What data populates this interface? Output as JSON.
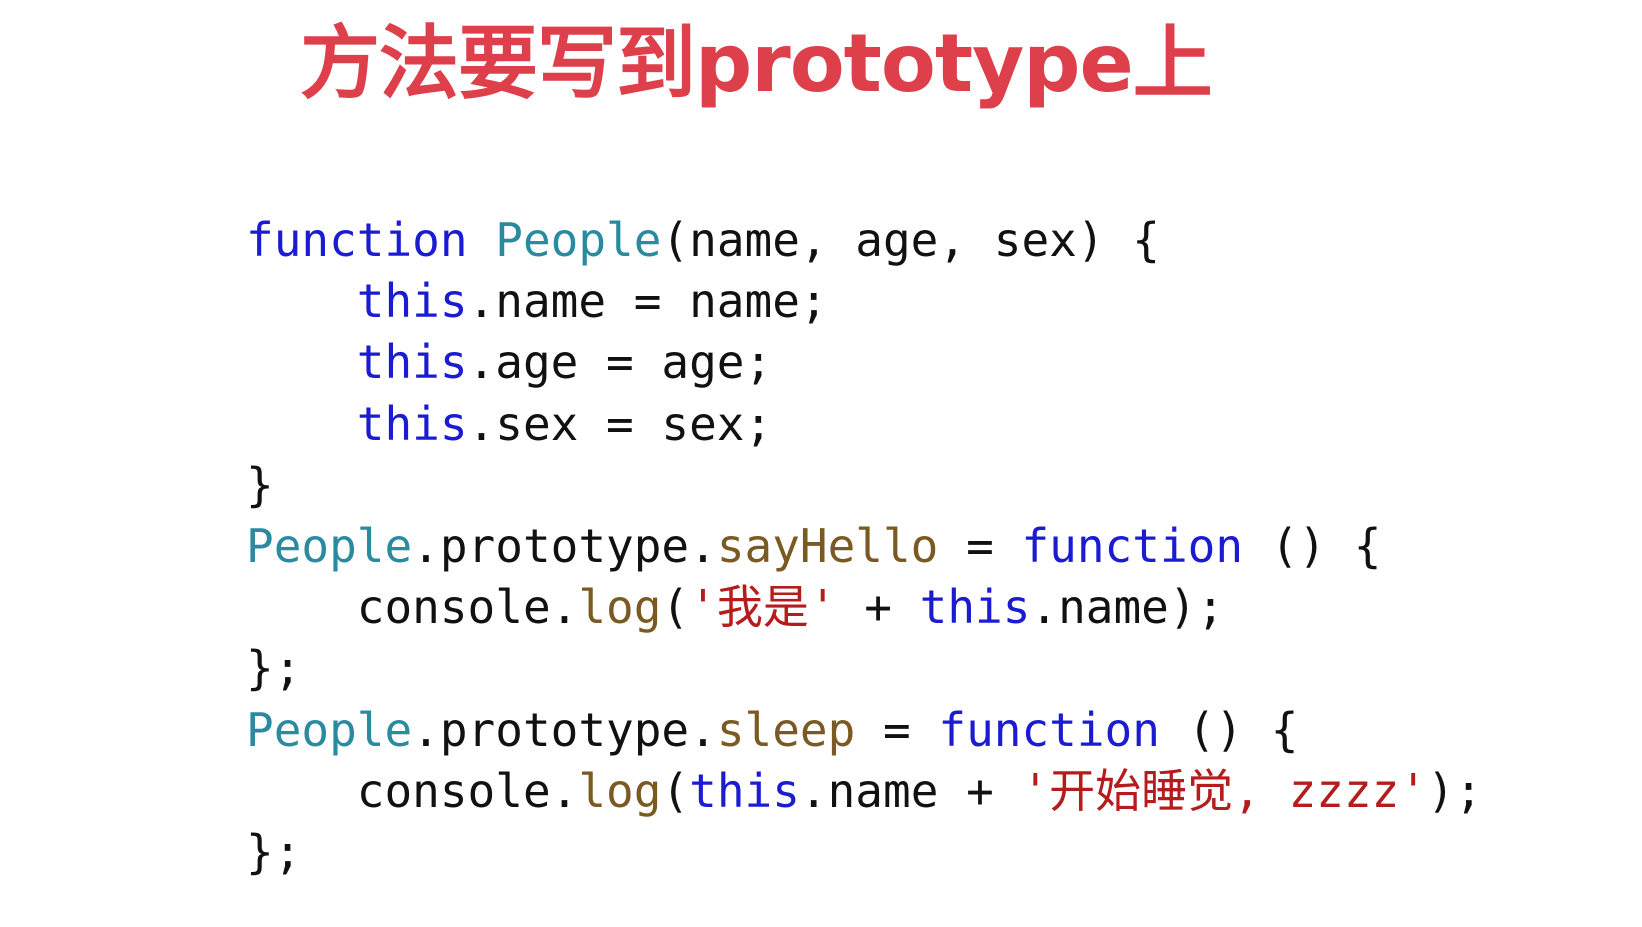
{
  "title": "方法要写到prototype上",
  "colors": {
    "title": "#dd3f4b",
    "keyword": "#1b1bd2",
    "type": "#2a8a9f",
    "method": "#7a5a22",
    "string": "#b51c1c",
    "plain": "#111111",
    "background": "#ffffff"
  },
  "code": {
    "language": "javascript",
    "lines": [
      [
        {
          "t": "function",
          "k": "keyword"
        },
        {
          "t": " ",
          "k": "plain"
        },
        {
          "t": "People",
          "k": "type"
        },
        {
          "t": "(name, age, sex) {",
          "k": "plain"
        }
      ],
      [
        {
          "t": "    ",
          "k": "plain"
        },
        {
          "t": "this",
          "k": "keyword"
        },
        {
          "t": ".name = name;",
          "k": "plain"
        }
      ],
      [
        {
          "t": "    ",
          "k": "plain"
        },
        {
          "t": "this",
          "k": "keyword"
        },
        {
          "t": ".age = age;",
          "k": "plain"
        }
      ],
      [
        {
          "t": "    ",
          "k": "plain"
        },
        {
          "t": "this",
          "k": "keyword"
        },
        {
          "t": ".sex = sex;",
          "k": "plain"
        }
      ],
      [
        {
          "t": "}",
          "k": "plain"
        }
      ],
      [
        {
          "t": "People",
          "k": "type"
        },
        {
          "t": ".prototype.",
          "k": "plain"
        },
        {
          "t": "sayHello",
          "k": "method"
        },
        {
          "t": " = ",
          "k": "plain"
        },
        {
          "t": "function",
          "k": "keyword"
        },
        {
          "t": " () {",
          "k": "plain"
        }
      ],
      [
        {
          "t": "    console.",
          "k": "plain"
        },
        {
          "t": "log",
          "k": "method"
        },
        {
          "t": "(",
          "k": "plain"
        },
        {
          "t": "'我是'",
          "k": "string"
        },
        {
          "t": " + ",
          "k": "plain"
        },
        {
          "t": "this",
          "k": "keyword"
        },
        {
          "t": ".name);",
          "k": "plain"
        }
      ],
      [
        {
          "t": "};",
          "k": "plain"
        }
      ],
      [
        {
          "t": "People",
          "k": "type"
        },
        {
          "t": ".prototype.",
          "k": "plain"
        },
        {
          "t": "sleep",
          "k": "method"
        },
        {
          "t": " = ",
          "k": "plain"
        },
        {
          "t": "function",
          "k": "keyword"
        },
        {
          "t": " () {",
          "k": "plain"
        }
      ],
      [
        {
          "t": "    console.",
          "k": "plain"
        },
        {
          "t": "log",
          "k": "method"
        },
        {
          "t": "(",
          "k": "plain"
        },
        {
          "t": "this",
          "k": "keyword"
        },
        {
          "t": ".name + ",
          "k": "plain"
        },
        {
          "t": "'开始睡觉, zzzz'",
          "k": "string"
        },
        {
          "t": ");",
          "k": "plain"
        }
      ],
      [
        {
          "t": "};",
          "k": "plain"
        }
      ]
    ]
  }
}
